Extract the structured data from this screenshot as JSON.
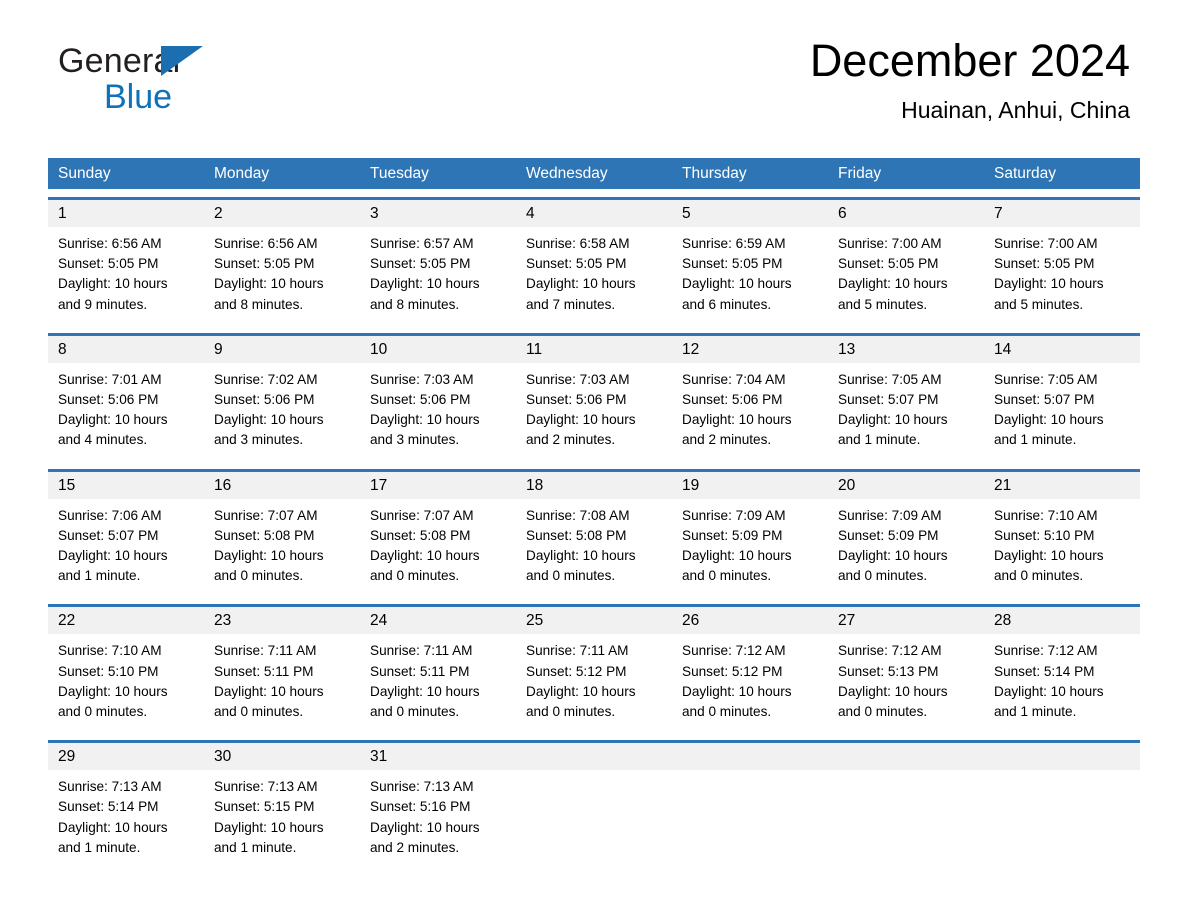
{
  "brand": {
    "name_part1": "General",
    "name_part2": "Blue"
  },
  "header": {
    "title": "December 2024",
    "location": "Huainan, Anhui, China"
  },
  "colors": {
    "header_blue": "#2e75b6",
    "brand_blue": "#0d72b9",
    "day_band_gray": "#f1f1f1",
    "text_black": "#000000"
  },
  "weekdays": [
    "Sunday",
    "Monday",
    "Tuesday",
    "Wednesday",
    "Thursday",
    "Friday",
    "Saturday"
  ],
  "weeks": [
    [
      {
        "day": "1",
        "sunrise": "Sunrise: 6:56 AM",
        "sunset": "Sunset: 5:05 PM",
        "daylight_line1": "Daylight: 10 hours",
        "daylight_line2": "and 9 minutes."
      },
      {
        "day": "2",
        "sunrise": "Sunrise: 6:56 AM",
        "sunset": "Sunset: 5:05 PM",
        "daylight_line1": "Daylight: 10 hours",
        "daylight_line2": "and 8 minutes."
      },
      {
        "day": "3",
        "sunrise": "Sunrise: 6:57 AM",
        "sunset": "Sunset: 5:05 PM",
        "daylight_line1": "Daylight: 10 hours",
        "daylight_line2": "and 8 minutes."
      },
      {
        "day": "4",
        "sunrise": "Sunrise: 6:58 AM",
        "sunset": "Sunset: 5:05 PM",
        "daylight_line1": "Daylight: 10 hours",
        "daylight_line2": "and 7 minutes."
      },
      {
        "day": "5",
        "sunrise": "Sunrise: 6:59 AM",
        "sunset": "Sunset: 5:05 PM",
        "daylight_line1": "Daylight: 10 hours",
        "daylight_line2": "and 6 minutes."
      },
      {
        "day": "6",
        "sunrise": "Sunrise: 7:00 AM",
        "sunset": "Sunset: 5:05 PM",
        "daylight_line1": "Daylight: 10 hours",
        "daylight_line2": "and 5 minutes."
      },
      {
        "day": "7",
        "sunrise": "Sunrise: 7:00 AM",
        "sunset": "Sunset: 5:05 PM",
        "daylight_line1": "Daylight: 10 hours",
        "daylight_line2": "and 5 minutes."
      }
    ],
    [
      {
        "day": "8",
        "sunrise": "Sunrise: 7:01 AM",
        "sunset": "Sunset: 5:06 PM",
        "daylight_line1": "Daylight: 10 hours",
        "daylight_line2": "and 4 minutes."
      },
      {
        "day": "9",
        "sunrise": "Sunrise: 7:02 AM",
        "sunset": "Sunset: 5:06 PM",
        "daylight_line1": "Daylight: 10 hours",
        "daylight_line2": "and 3 minutes."
      },
      {
        "day": "10",
        "sunrise": "Sunrise: 7:03 AM",
        "sunset": "Sunset: 5:06 PM",
        "daylight_line1": "Daylight: 10 hours",
        "daylight_line2": "and 3 minutes."
      },
      {
        "day": "11",
        "sunrise": "Sunrise: 7:03 AM",
        "sunset": "Sunset: 5:06 PM",
        "daylight_line1": "Daylight: 10 hours",
        "daylight_line2": "and 2 minutes."
      },
      {
        "day": "12",
        "sunrise": "Sunrise: 7:04 AM",
        "sunset": "Sunset: 5:06 PM",
        "daylight_line1": "Daylight: 10 hours",
        "daylight_line2": "and 2 minutes."
      },
      {
        "day": "13",
        "sunrise": "Sunrise: 7:05 AM",
        "sunset": "Sunset: 5:07 PM",
        "daylight_line1": "Daylight: 10 hours",
        "daylight_line2": "and 1 minute."
      },
      {
        "day": "14",
        "sunrise": "Sunrise: 7:05 AM",
        "sunset": "Sunset: 5:07 PM",
        "daylight_line1": "Daylight: 10 hours",
        "daylight_line2": "and 1 minute."
      }
    ],
    [
      {
        "day": "15",
        "sunrise": "Sunrise: 7:06 AM",
        "sunset": "Sunset: 5:07 PM",
        "daylight_line1": "Daylight: 10 hours",
        "daylight_line2": "and 1 minute."
      },
      {
        "day": "16",
        "sunrise": "Sunrise: 7:07 AM",
        "sunset": "Sunset: 5:08 PM",
        "daylight_line1": "Daylight: 10 hours",
        "daylight_line2": "and 0 minutes."
      },
      {
        "day": "17",
        "sunrise": "Sunrise: 7:07 AM",
        "sunset": "Sunset: 5:08 PM",
        "daylight_line1": "Daylight: 10 hours",
        "daylight_line2": "and 0 minutes."
      },
      {
        "day": "18",
        "sunrise": "Sunrise: 7:08 AM",
        "sunset": "Sunset: 5:08 PM",
        "daylight_line1": "Daylight: 10 hours",
        "daylight_line2": "and 0 minutes."
      },
      {
        "day": "19",
        "sunrise": "Sunrise: 7:09 AM",
        "sunset": "Sunset: 5:09 PM",
        "daylight_line1": "Daylight: 10 hours",
        "daylight_line2": "and 0 minutes."
      },
      {
        "day": "20",
        "sunrise": "Sunrise: 7:09 AM",
        "sunset": "Sunset: 5:09 PM",
        "daylight_line1": "Daylight: 10 hours",
        "daylight_line2": "and 0 minutes."
      },
      {
        "day": "21",
        "sunrise": "Sunrise: 7:10 AM",
        "sunset": "Sunset: 5:10 PM",
        "daylight_line1": "Daylight: 10 hours",
        "daylight_line2": "and 0 minutes."
      }
    ],
    [
      {
        "day": "22",
        "sunrise": "Sunrise: 7:10 AM",
        "sunset": "Sunset: 5:10 PM",
        "daylight_line1": "Daylight: 10 hours",
        "daylight_line2": "and 0 minutes."
      },
      {
        "day": "23",
        "sunrise": "Sunrise: 7:11 AM",
        "sunset": "Sunset: 5:11 PM",
        "daylight_line1": "Daylight: 10 hours",
        "daylight_line2": "and 0 minutes."
      },
      {
        "day": "24",
        "sunrise": "Sunrise: 7:11 AM",
        "sunset": "Sunset: 5:11 PM",
        "daylight_line1": "Daylight: 10 hours",
        "daylight_line2": "and 0 minutes."
      },
      {
        "day": "25",
        "sunrise": "Sunrise: 7:11 AM",
        "sunset": "Sunset: 5:12 PM",
        "daylight_line1": "Daylight: 10 hours",
        "daylight_line2": "and 0 minutes."
      },
      {
        "day": "26",
        "sunrise": "Sunrise: 7:12 AM",
        "sunset": "Sunset: 5:12 PM",
        "daylight_line1": "Daylight: 10 hours",
        "daylight_line2": "and 0 minutes."
      },
      {
        "day": "27",
        "sunrise": "Sunrise: 7:12 AM",
        "sunset": "Sunset: 5:13 PM",
        "daylight_line1": "Daylight: 10 hours",
        "daylight_line2": "and 0 minutes."
      },
      {
        "day": "28",
        "sunrise": "Sunrise: 7:12 AM",
        "sunset": "Sunset: 5:14 PM",
        "daylight_line1": "Daylight: 10 hours",
        "daylight_line2": "and 1 minute."
      }
    ],
    [
      {
        "day": "29",
        "sunrise": "Sunrise: 7:13 AM",
        "sunset": "Sunset: 5:14 PM",
        "daylight_line1": "Daylight: 10 hours",
        "daylight_line2": "and 1 minute."
      },
      {
        "day": "30",
        "sunrise": "Sunrise: 7:13 AM",
        "sunset": "Sunset: 5:15 PM",
        "daylight_line1": "Daylight: 10 hours",
        "daylight_line2": "and 1 minute."
      },
      {
        "day": "31",
        "sunrise": "Sunrise: 7:13 AM",
        "sunset": "Sunset: 5:16 PM",
        "daylight_line1": "Daylight: 10 hours",
        "daylight_line2": "and 2 minutes."
      },
      {
        "day": "",
        "sunrise": "",
        "sunset": "",
        "daylight_line1": "",
        "daylight_line2": ""
      },
      {
        "day": "",
        "sunrise": "",
        "sunset": "",
        "daylight_line1": "",
        "daylight_line2": ""
      },
      {
        "day": "",
        "sunrise": "",
        "sunset": "",
        "daylight_line1": "",
        "daylight_line2": ""
      },
      {
        "day": "",
        "sunrise": "",
        "sunset": "",
        "daylight_line1": "",
        "daylight_line2": ""
      }
    ]
  ]
}
